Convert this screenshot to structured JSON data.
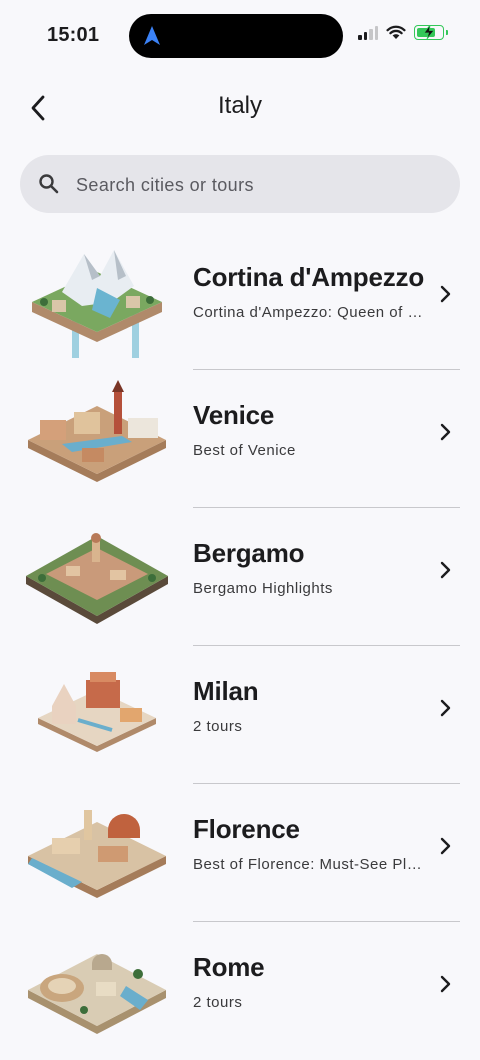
{
  "status_bar": {
    "time": "15:01"
  },
  "header": {
    "title": "Italy"
  },
  "search": {
    "placeholder": "Search cities or tours"
  },
  "cities": [
    {
      "name": "Cortina d'Ampezzo",
      "subtitle": "Cortina d'Ampezzo: Queen of the Dolomites"
    },
    {
      "name": "Venice",
      "subtitle": "Best of Venice"
    },
    {
      "name": "Bergamo",
      "subtitle": "Bergamo Highlights"
    },
    {
      "name": "Milan",
      "subtitle": "2 tours"
    },
    {
      "name": "Florence",
      "subtitle": "Best of Florence: Must-See Places"
    },
    {
      "name": "Rome",
      "subtitle": "2 tours"
    }
  ],
  "colors": {
    "background": "#f8f8fb",
    "search_bg": "#e5e5ea",
    "battery": "#34c759",
    "nav_arrow": "#3b82f6"
  }
}
